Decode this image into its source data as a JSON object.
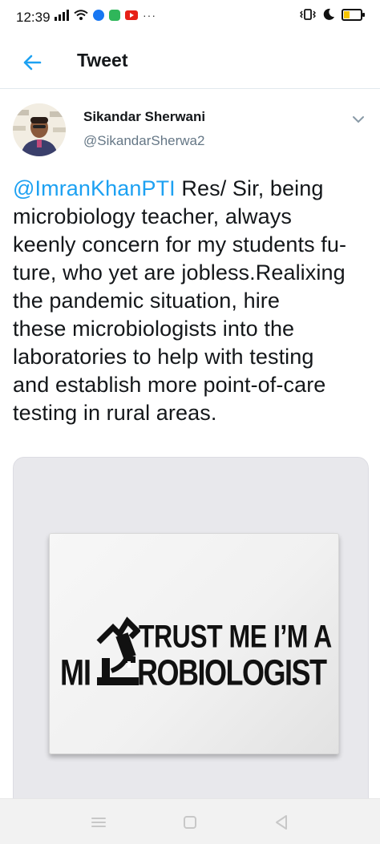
{
  "status_bar": {
    "time": "12:39",
    "more": "···",
    "icons": [
      "signal-icon",
      "wifi-icon",
      "facebook-icon",
      "message-icon",
      "youtube-icon",
      "vibrate-icon",
      "moon-icon",
      "battery-icon"
    ]
  },
  "header": {
    "title": "Tweet",
    "back_icon": "back-arrow-icon"
  },
  "tweet": {
    "author_name": "Sikandar Sherwani",
    "author_handle": "@SikandarSherwa2",
    "mention": "@ImranKhanPTI",
    "text": " Res/ Sir, being\nmicrobiology teacher, always\nkeenly concern for my students fu-\nture, who yet are jobless.Realixing\nthe pandemic situation, hire\nthese microbiologists  into the\nlaboratories to help with testing\nand establish more point-of-care\ntesting in rural areas.",
    "image": {
      "line1": "TRUST ME I’M A",
      "prefix": "MI",
      "line2": "ROBIOLOGIST"
    }
  },
  "nav_bar": {
    "buttons": [
      "menu-icon",
      "home-icon",
      "back-icon"
    ]
  },
  "colors": {
    "accent": "#1da1f2",
    "text": "#14171a",
    "secondary": "#657786"
  }
}
